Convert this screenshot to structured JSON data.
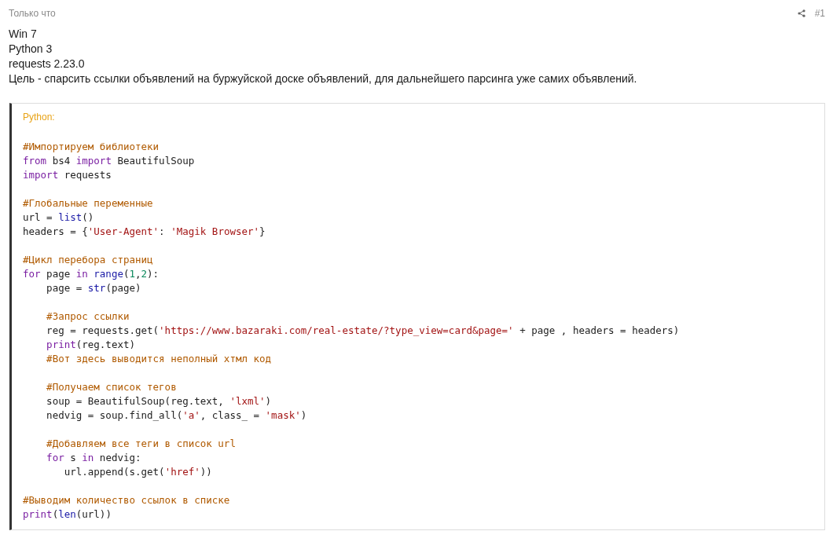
{
  "post": {
    "time": "Только что",
    "number": "#1",
    "paragraphs": [
      "Win 7",
      "Python 3",
      "requests 2.23.0",
      "Цель - спарсить ссылки объявлений на буржуйской доске объявлений, для дальнейшего парсинга уже самих объявлений."
    ]
  },
  "code": {
    "language": "Python:",
    "blocks": [
      [
        [
          {
            "kind": "com",
            "text": "#Импортируем библиотеки"
          }
        ],
        [
          {
            "kind": "kw",
            "text": "from"
          },
          {
            "kind": "plain",
            "text": " bs4 "
          },
          {
            "kind": "kw",
            "text": "import"
          },
          {
            "kind": "plain",
            "text": " BeautifulSoup"
          }
        ],
        [
          {
            "kind": "kw",
            "text": "import"
          },
          {
            "kind": "plain",
            "text": " requests"
          }
        ]
      ],
      [
        [
          {
            "kind": "com",
            "text": "#Глобальные переменные"
          }
        ],
        [
          {
            "kind": "plain",
            "text": "url = "
          },
          {
            "kind": "fn",
            "text": "list"
          },
          {
            "kind": "plain",
            "text": "()"
          }
        ],
        [
          {
            "kind": "plain",
            "text": "headers = {"
          },
          {
            "kind": "str",
            "text": "'User-Agent'"
          },
          {
            "kind": "plain",
            "text": ": "
          },
          {
            "kind": "str",
            "text": "'Magik Browser'"
          },
          {
            "kind": "plain",
            "text": "}"
          }
        ]
      ],
      [
        [
          {
            "kind": "com",
            "text": "#Цикл перебора страниц"
          }
        ],
        [
          {
            "kind": "kw",
            "text": "for"
          },
          {
            "kind": "plain",
            "text": " page "
          },
          {
            "kind": "kw",
            "text": "in"
          },
          {
            "kind": "fn",
            "text": " range"
          },
          {
            "kind": "plain",
            "text": "("
          },
          {
            "kind": "num",
            "text": "1"
          },
          {
            "kind": "plain",
            "text": ","
          },
          {
            "kind": "num",
            "text": "2"
          },
          {
            "kind": "plain",
            "text": "):"
          }
        ],
        [
          {
            "kind": "plain",
            "text": "    page = "
          },
          {
            "kind": "fn",
            "text": "str"
          },
          {
            "kind": "plain",
            "text": "(page)"
          }
        ]
      ],
      [
        [
          {
            "kind": "com",
            "text": "    #Запрос ссылки"
          }
        ],
        [
          {
            "kind": "plain",
            "text": "    reg = requests.get("
          },
          {
            "kind": "str",
            "text": "'https://www.bazaraki.com/real-estate/?type_view=card&page='"
          },
          {
            "kind": "plain",
            "text": " + page , headers = headers)"
          }
        ],
        [
          {
            "kind": "kw",
            "text": "    print"
          },
          {
            "kind": "plain",
            "text": "(reg.text)"
          }
        ],
        [
          {
            "kind": "com",
            "text": "    #Вот здесь выводится неполный хтмл код"
          }
        ]
      ],
      [
        [
          {
            "kind": "com",
            "text": "    #Получаем список тегов"
          }
        ],
        [
          {
            "kind": "plain",
            "text": "    soup = BeautifulSoup(reg.text, "
          },
          {
            "kind": "str",
            "text": "'lxml'"
          },
          {
            "kind": "plain",
            "text": ")"
          }
        ],
        [
          {
            "kind": "plain",
            "text": "    nedvig = soup.find_all("
          },
          {
            "kind": "str",
            "text": "'a'"
          },
          {
            "kind": "plain",
            "text": ", class_ = "
          },
          {
            "kind": "str",
            "text": "'mask'"
          },
          {
            "kind": "plain",
            "text": ")"
          }
        ]
      ],
      [
        [
          {
            "kind": "com",
            "text": "    #Добавляем все теги в список url"
          }
        ],
        [
          {
            "kind": "kw",
            "text": "    for"
          },
          {
            "kind": "plain",
            "text": " s "
          },
          {
            "kind": "kw",
            "text": "in"
          },
          {
            "kind": "plain",
            "text": " nedvig:"
          }
        ],
        [
          {
            "kind": "plain",
            "text": "       url.append(s.get("
          },
          {
            "kind": "str",
            "text": "'href'"
          },
          {
            "kind": "plain",
            "text": "))"
          }
        ]
      ],
      [
        [
          {
            "kind": "com",
            "text": "#Выводим количество ссылок в списке"
          }
        ],
        [
          {
            "kind": "kw",
            "text": "print"
          },
          {
            "kind": "plain",
            "text": "("
          },
          {
            "kind": "fn",
            "text": "len"
          },
          {
            "kind": "plain",
            "text": "(url))"
          }
        ]
      ]
    ]
  }
}
